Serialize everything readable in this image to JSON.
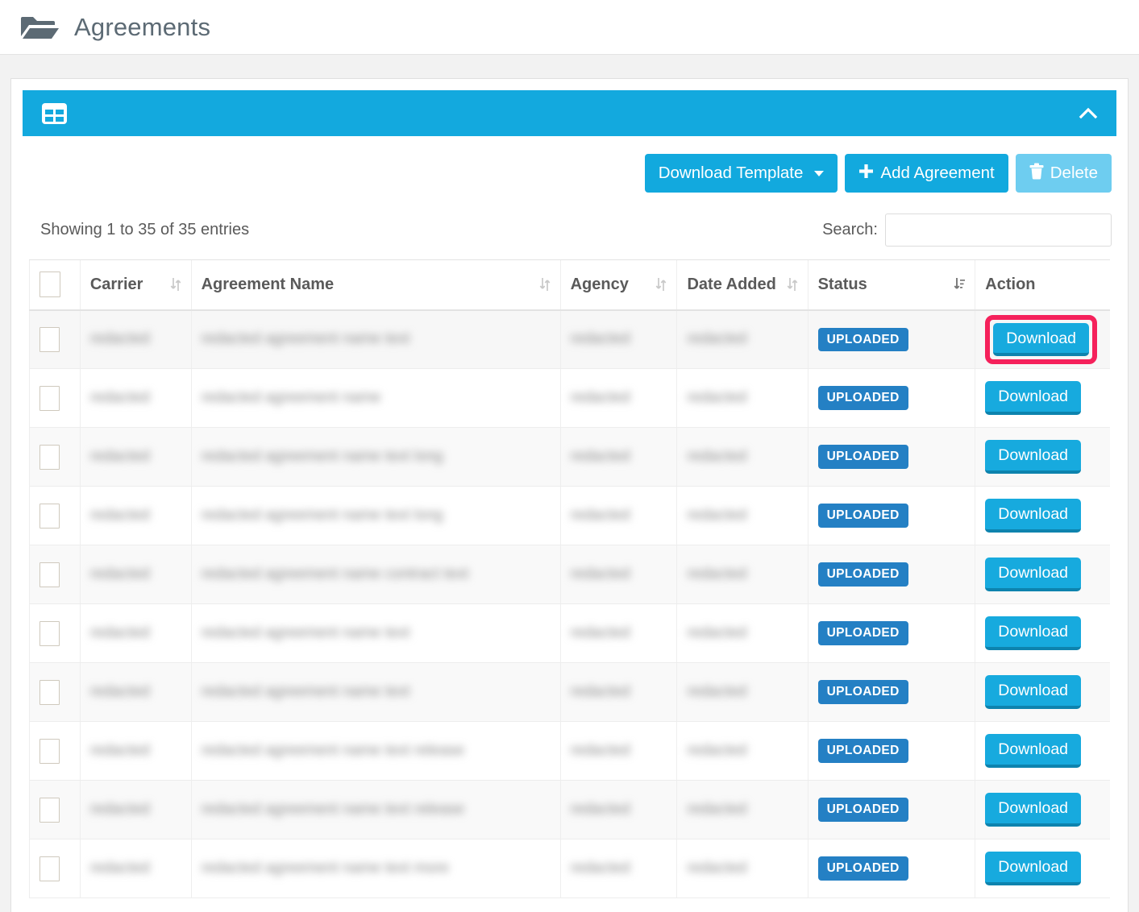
{
  "header": {
    "title": "Agreements",
    "folder_icon": "folder-open-icon"
  },
  "panel": {
    "icon": "table-grid-icon",
    "collapse_icon": "chevron-up-icon"
  },
  "toolbar": {
    "download_template_label": "Download Template",
    "download_template_caret": "caret-down-icon",
    "add_agreement_label": "Add Agreement",
    "add_agreement_icon": "plus-icon",
    "delete_label": "Delete",
    "delete_icon": "trash-icon",
    "delete_disabled": true
  },
  "table_info": {
    "showing": "Showing 1 to 35 of 35 entries",
    "search_label": "Search:",
    "search_value": "",
    "search_placeholder": ""
  },
  "columns": [
    {
      "key": "select",
      "label": "",
      "sortable": false,
      "sort": "none"
    },
    {
      "key": "carrier",
      "label": "Carrier",
      "sortable": true,
      "sort": "none"
    },
    {
      "key": "name",
      "label": "Agreement Name",
      "sortable": true,
      "sort": "none"
    },
    {
      "key": "agency",
      "label": "Agency",
      "sortable": true,
      "sort": "none"
    },
    {
      "key": "date",
      "label": "Date Added",
      "sortable": true,
      "sort": "none"
    },
    {
      "key": "status",
      "label": "Status",
      "sortable": true,
      "sort": "desc"
    },
    {
      "key": "action",
      "label": "Action",
      "sortable": false,
      "sort": "none"
    }
  ],
  "rows": [
    {
      "carrier": "redacted",
      "name": "redacted agreement name text",
      "agency": "redacted",
      "date": "redacted",
      "status": "UPLOADED",
      "action": "Download",
      "highlighted": true
    },
    {
      "carrier": "redacted",
      "name": "redacted agreement name",
      "agency": "redacted",
      "date": "redacted",
      "status": "UPLOADED",
      "action": "Download",
      "highlighted": false
    },
    {
      "carrier": "redacted",
      "name": "redacted agreement name text long",
      "agency": "redacted",
      "date": "redacted",
      "status": "UPLOADED",
      "action": "Download",
      "highlighted": false
    },
    {
      "carrier": "redacted",
      "name": "redacted agreement name text long",
      "agency": "redacted",
      "date": "redacted",
      "status": "UPLOADED",
      "action": "Download",
      "highlighted": false
    },
    {
      "carrier": "redacted",
      "name": "redacted agreement name contract text",
      "agency": "redacted",
      "date": "redacted",
      "status": "UPLOADED",
      "action": "Download",
      "highlighted": false
    },
    {
      "carrier": "redacted",
      "name": "redacted agreement name text",
      "agency": "redacted",
      "date": "redacted",
      "status": "UPLOADED",
      "action": "Download",
      "highlighted": false
    },
    {
      "carrier": "redacted",
      "name": "redacted agreement name text",
      "agency": "redacted",
      "date": "redacted",
      "status": "UPLOADED",
      "action": "Download",
      "highlighted": false
    },
    {
      "carrier": "redacted",
      "name": "redacted agreement name text release",
      "agency": "redacted",
      "date": "redacted",
      "status": "UPLOADED",
      "action": "Download",
      "highlighted": false
    },
    {
      "carrier": "redacted",
      "name": "redacted agreement name text release",
      "agency": "redacted",
      "date": "redacted",
      "status": "UPLOADED",
      "action": "Download",
      "highlighted": false
    },
    {
      "carrier": "redacted",
      "name": "redacted agreement name text more",
      "agency": "redacted",
      "date": "redacted",
      "status": "UPLOADED",
      "action": "Download",
      "highlighted": false
    }
  ],
  "colors": {
    "panel_cyan": "#13a9de",
    "button_cyan": "#12a9de",
    "button_cyan_disabled": "#6ecdf0",
    "badge_blue": "#2480c4",
    "highlight_pink": "#f5215b",
    "page_bg": "#f2f2f2",
    "title_gray": "#5c6a74"
  }
}
